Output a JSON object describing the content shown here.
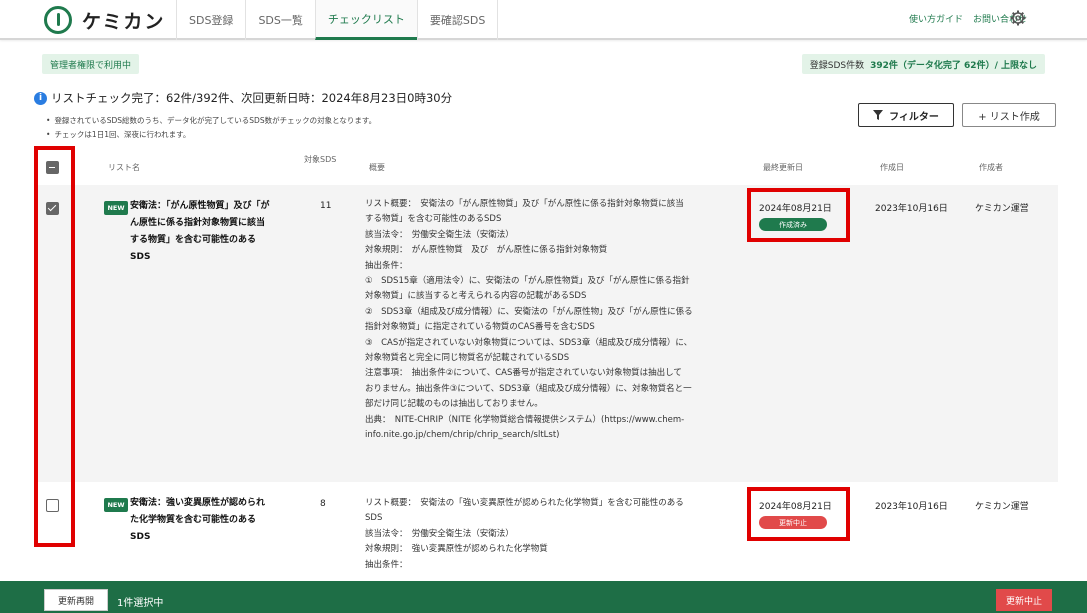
{
  "header": {
    "logo_text": "ケミカン",
    "tabs": [
      "SDS登録",
      "SDS一覧",
      "チェックリスト",
      "要確認SDS"
    ],
    "active_tab": 2,
    "links": [
      "使い方ガイド",
      "お問い合わせ"
    ]
  },
  "badges": {
    "admin": "管理者権限で利用中",
    "registered_label": "登録SDS件数",
    "registered_value": "392件（データ化完了 62件）/ 上限なし"
  },
  "status": {
    "message": "リストチェック完了：62件/392件、次回更新日時：2024年8月23日0時30分",
    "notes": [
      "登録されているSDS総数のうち、データ化が完了しているSDS数がチェックの対象となります。",
      "チェックは1日1回、深夜に行われます。"
    ]
  },
  "actions": {
    "filter_label": "フィルター",
    "create_label": "+ リスト作成"
  },
  "table": {
    "headers": {
      "name": "リスト名",
      "count": "対象SDS",
      "summary": "概要",
      "updated": "最終更新日",
      "created": "作成日",
      "author": "作成者"
    },
    "rows": [
      {
        "tag": "NEW",
        "checked": true,
        "name_lines": [
          "安衛法：「がん原性物質」及び「が",
          "ん原性に係る指針対象物質に該当",
          "する物質」を含む可能性のある",
          "SDS"
        ],
        "count": "11",
        "summary_lines": [
          "リスト概要：　安衛法の「がん原性物質」及び「がん原性に係る指針対象物質に該当",
          "する物質」を含む可能性のあるSDS",
          "該当法令：　労働安全衛生法（安衛法）",
          "対象規則：　がん原性物質　及び　がん原性に係る指針対象物質",
          "抽出条件：",
          "①　SDS15章（適用法令）に、安衛法の「がん原性物質」及び「がん原性に係る指針",
          "対象物質」に該当すると考えられる内容の記載があるSDS",
          "②　SDS3章（組成及び成分情報）に、安衛法の「がん原性物」及び「がん原性に係る",
          "指針対象物質」に指定されている物質のCAS番号を含むSDS",
          "③　CASが指定されていない対象物質については、SDS3章（組成及び成分情報）に、",
          "対象物質名と完全に同じ物質名が記載されているSDS",
          "注意事項：　抽出条件②について、CAS番号が指定されていない対象物質は抽出して",
          "おりません。抽出条件③について、SDS3章（組成及び成分情報）に、対象物質名と一",
          "部だけ同じ記載のものは抽出しておりません。",
          "出典：　NITE-CHRIP（NITE 化学物質総合情報提供システム）(https://www.chem-",
          "info.nite.go.jp/chem/chrip/chrip_search/sltLst)"
        ],
        "updated": "2024年08月21日",
        "state": "作成済み",
        "created": "2023年10月16日",
        "author": "ケミカン運営"
      },
      {
        "tag": "NEW",
        "checked": false,
        "name_lines": [
          "安衛法：強い変異原性が認められ",
          "た化学物質を含む可能性のある",
          "SDS"
        ],
        "count": "8",
        "summary_lines": [
          "リスト概要：　安衛法の「強い変異原性が認められた化学物質」を含む可能性のある",
          "SDS",
          "該当法令：　労働安全衛生法（安衛法）",
          "対象規則：　強い変異原性が認められた化学物質",
          "抽出条件："
        ],
        "updated": "2024年08月21日",
        "state": "更新中止",
        "created": "2023年10月16日",
        "author": "ケミカン運営"
      }
    ]
  },
  "footer": {
    "resume_label": "更新再開",
    "selection": "1件選択中",
    "stop_label": "更新中止"
  },
  "colors": {
    "brand_green": "#1f7a4d",
    "stop_red": "#e14a4a",
    "highlight_red": "#e00000"
  }
}
